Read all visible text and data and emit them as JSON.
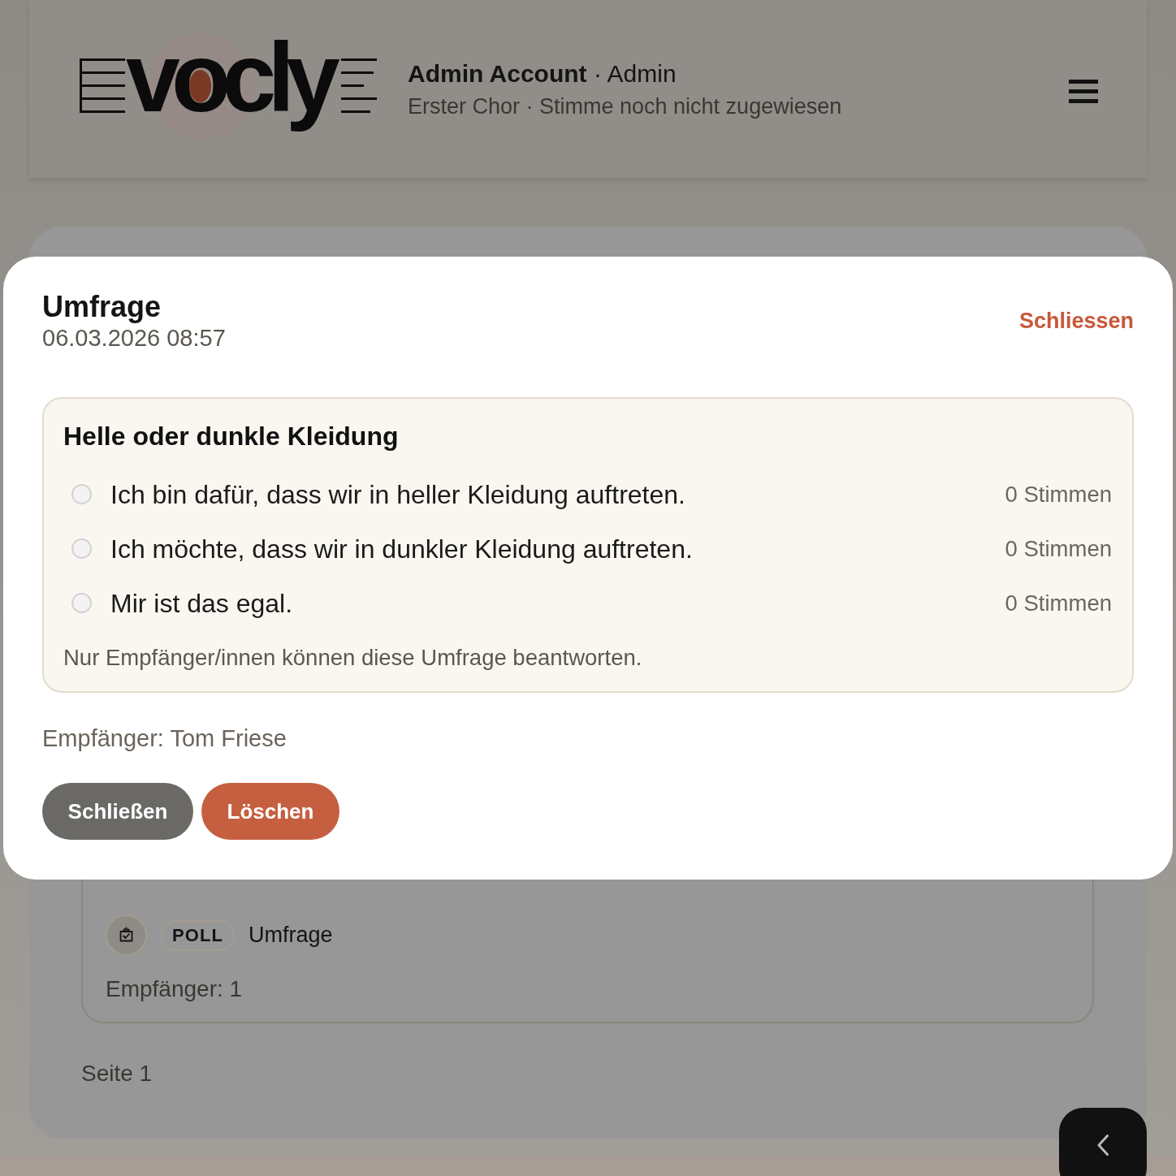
{
  "header": {
    "logo": "vocly",
    "account": "**Admin Account** · Admin",
    "subtitle": "Erster Chor · Stimme noch nicht zugewiesen"
  },
  "list": {
    "item": {
      "type_badge": "POLL",
      "type_label": "Umfrage",
      "recipients": "Empfänger: 1"
    },
    "pagination": "Seite 1"
  },
  "modal": {
    "title": "Umfrage",
    "date": "06.03.2026 08:57",
    "close_link": "Schliessen",
    "poll": {
      "question": "Helle oder dunkle Kleidung",
      "options": [
        {
          "label": "Ich bin dafür, dass wir in heller Kleidung auftreten.",
          "votes": "0 Stimmen",
          "selected": false
        },
        {
          "label": "Ich möchte, dass wir in dunkler Kleidung auftreten.",
          "votes": "0 Stimmen",
          "selected": false
        },
        {
          "label": "Mir ist das egal.",
          "votes": "0 Stimmen",
          "selected": false
        }
      ],
      "note": "Nur Empfänger/innen können diese Umfrage beantworten."
    },
    "recipients": "Empfänger: Tom Friese",
    "buttons": [
      {
        "label": "Schließen",
        "kind": "neutral"
      },
      {
        "label": "Löschen",
        "kind": "danger"
      }
    ]
  }
}
